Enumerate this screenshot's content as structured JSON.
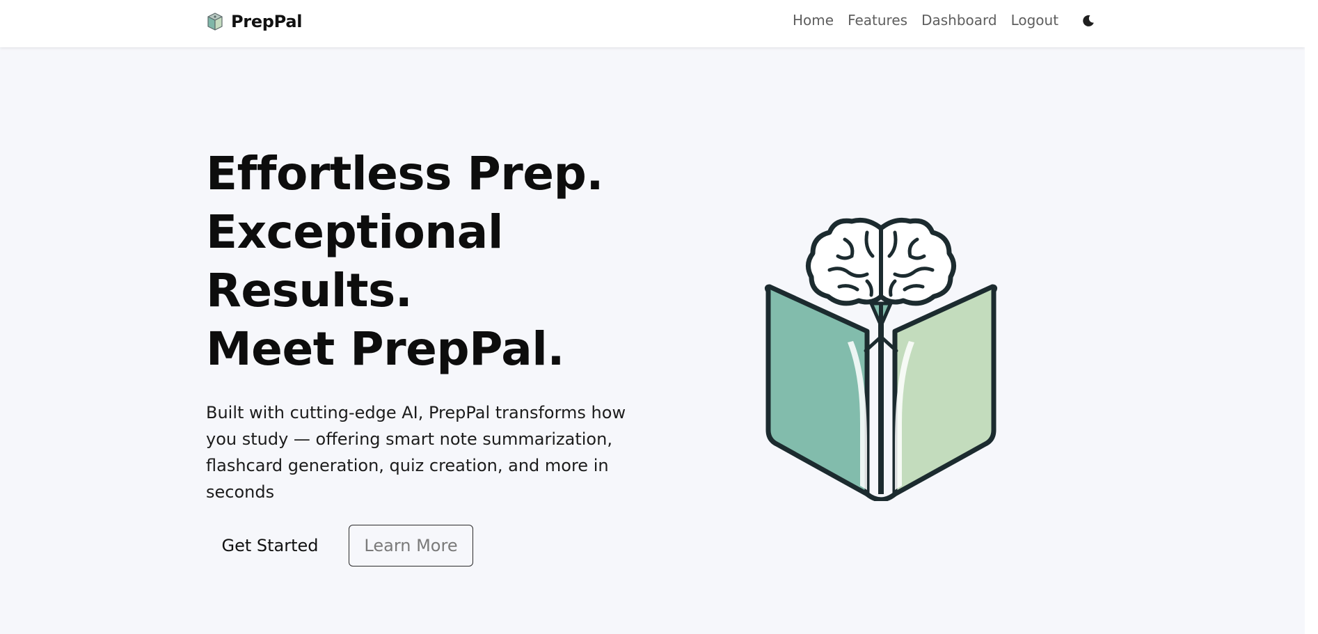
{
  "navbar": {
    "brand_name": "PrepPal",
    "brand_icon": "book-cube-logo-icon",
    "links": [
      {
        "label": "Home"
      },
      {
        "label": "Features"
      },
      {
        "label": "Dashboard"
      },
      {
        "label": "Logout"
      }
    ],
    "theme_toggle_icon": "moon-icon"
  },
  "hero": {
    "title_lines": [
      "Effortless Prep.",
      "Exceptional",
      "Results.",
      "Meet PrepPal."
    ],
    "description": "Built with cutting-edge AI, PrepPal transforms how you study — offering smart note summarization, flashcard generation, quiz creation, and more in seconds",
    "primary_button": "Get Started",
    "secondary_button": "Learn More",
    "illustration": "brain-book-icon"
  },
  "colors": {
    "page_background": "#f6f7fb",
    "navbar_background": "#ffffff",
    "heading_text": "#0d0d0d",
    "nav_text": "#5e5e5e",
    "book_left": "#82bcac",
    "book_right": "#c3dcbd",
    "outline": "#1c2b2f"
  }
}
